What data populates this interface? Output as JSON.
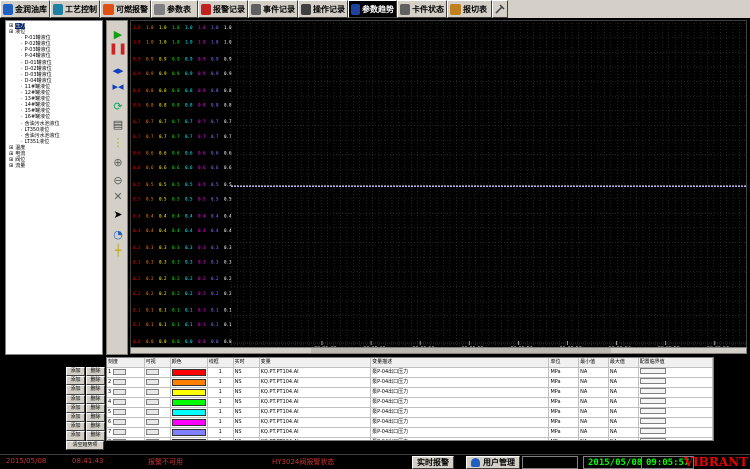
{
  "toolbar": {
    "tabs": [
      {
        "label": "金润油库",
        "icon": "monitor-icon",
        "color": "#2060c0"
      },
      {
        "label": "工艺控制",
        "icon": "globe-icon",
        "color": "#2080a0"
      },
      {
        "label": "可燃报警",
        "icon": "fire-icon",
        "color": "#e05010"
      },
      {
        "label": "参数表",
        "icon": "pen-icon",
        "color": "#808080"
      },
      {
        "label": "报警记录",
        "icon": "book-icon",
        "color": "#c02020"
      },
      {
        "label": "事件记录",
        "icon": "list-icon",
        "color": "#606060"
      },
      {
        "label": "操作记录",
        "icon": "notes-icon",
        "color": "#404040"
      },
      {
        "label": "参数趋势",
        "icon": "trend-icon",
        "color": "#2040a0"
      },
      {
        "label": "卡件状态",
        "icon": "card-icon",
        "color": "#606060"
      },
      {
        "label": "报切表",
        "icon": "switch-icon",
        "color": "#c08020"
      }
    ],
    "active_tab": "参数趋势",
    "end_icon": "tools-icon"
  },
  "tree": {
    "items": [
      {
        "label": "压力",
        "level": 0,
        "selected": true
      },
      {
        "label": "液位",
        "level": 0
      },
      {
        "label": "P-01罐液位",
        "level": 1
      },
      {
        "label": "P-02罐液位",
        "level": 1
      },
      {
        "label": "P-03罐液位",
        "level": 1
      },
      {
        "label": "P-04罐液位",
        "level": 1
      },
      {
        "label": "D-01罐液位",
        "level": 1
      },
      {
        "label": "D-02罐液位",
        "level": 1
      },
      {
        "label": "D-03罐液位",
        "level": 1
      },
      {
        "label": "D-04罐液位",
        "level": 1
      },
      {
        "label": "11#罐液位",
        "level": 1
      },
      {
        "label": "12#罐液位",
        "level": 1
      },
      {
        "label": "13#罐液位",
        "level": 1
      },
      {
        "label": "14#罐液位",
        "level": 1
      },
      {
        "label": "15#罐液位",
        "level": 1
      },
      {
        "label": "16#罐液位",
        "level": 1
      },
      {
        "label": "含油污水池液位",
        "level": 1
      },
      {
        "label": "LT350液位",
        "level": 1
      },
      {
        "label": "含油污水池液位",
        "level": 1
      },
      {
        "label": "LT351液位",
        "level": 1
      },
      {
        "label": "温度",
        "level": 0
      },
      {
        "label": "电流",
        "level": 0
      },
      {
        "label": "阀位",
        "level": 0
      },
      {
        "label": "流量",
        "level": 0
      }
    ]
  },
  "tools": [
    {
      "name": "play-icon",
      "glyph": "▶",
      "color": "#10a010"
    },
    {
      "name": "pause-icon",
      "glyph": "❚❚",
      "color": "#d02020"
    },
    {
      "name": "expand-horizontal-icon",
      "glyph": "◂▸",
      "color": "#1040c0"
    },
    {
      "name": "shrink-horizontal-icon",
      "glyph": "▸◂",
      "color": "#1040c0"
    },
    {
      "name": "refresh-icon",
      "glyph": "⟳",
      "color": "#10a060"
    },
    {
      "name": "print-icon",
      "glyph": "▤",
      "color": "#404040"
    },
    {
      "name": "cursor-line-icon",
      "glyph": "⋮",
      "color": "#c0a000"
    },
    {
      "name": "zoom-in-icon",
      "glyph": "⊕",
      "color": "#606060"
    },
    {
      "name": "zoom-out-icon",
      "glyph": "⊖",
      "color": "#606060"
    },
    {
      "name": "zoom-reset-icon",
      "glyph": "✕",
      "color": "#606060"
    },
    {
      "name": "arrow-pointer-icon",
      "glyph": "➤",
      "color": "#000"
    },
    {
      "name": "history-icon",
      "glyph": "◔",
      "color": "#2060c0"
    },
    {
      "name": "crosshair-icon",
      "glyph": "┼",
      "color": "#c0a000"
    }
  ],
  "chart_data": {
    "type": "line",
    "x_tick_labels": [
      "09:05:48",
      "09:05:49",
      "09:05:50",
      "09:05:51",
      "09:05:52",
      "09:05:53",
      "09:05:54",
      "09:05:55",
      "09:05:56",
      "09:05:57"
    ],
    "y_scale_count": 8,
    "y_scale_labels": [
      "1.0",
      "0.9",
      "0.8",
      "0.7",
      "0.6",
      "0.5",
      "0.4",
      "0.3",
      "0.2",
      "0.1",
      "0.0"
    ],
    "series": [
      {
        "name": "KQ.PT.PT104.AI",
        "color": "#ff0000"
      },
      {
        "name": "KQ.PT.PT104.AI",
        "color": "#ff8000"
      },
      {
        "name": "KQ.PT.PT104.AI",
        "color": "#ffff00"
      },
      {
        "name": "KQ.PT.PT104.AI",
        "color": "#00ff00"
      },
      {
        "name": "KQ.PT.PT104.AI",
        "color": "#00ffff"
      },
      {
        "name": "KQ.PT.PT104.AI",
        "color": "#ff00ff"
      },
      {
        "name": "KQ.PT.PT104.AI",
        "color": "#8080ff"
      },
      {
        "name": "KQ.PT.PT104.AI",
        "color": "#ffffff"
      }
    ],
    "trend_level": 0.5,
    "grid": true
  },
  "table": {
    "headers": [
      "刻度",
      "可视",
      "颜色",
      "线框",
      "实时",
      "变量",
      "变量描述",
      "单位",
      "最小值",
      "最大值",
      "配置临界值"
    ],
    "rows": [
      {
        "idx": "1",
        "color": "#ff0000",
        "width": "1",
        "realtime": "NS",
        "var": "KQ.PT.PT104.AI",
        "desc": "泵P-04出口压力",
        "unit": "MPa",
        "min": "NA",
        "max": "NA"
      },
      {
        "idx": "2",
        "color": "#ff8000",
        "width": "1",
        "realtime": "NS",
        "var": "KQ.PT.PT104.AI",
        "desc": "泵P-04出口压力",
        "unit": "MPa",
        "min": "NA",
        "max": "NA"
      },
      {
        "idx": "3",
        "color": "#ffff00",
        "width": "1",
        "realtime": "NS",
        "var": "KQ.PT.PT104.AI",
        "desc": "泵P-04出口压力",
        "unit": "MPa",
        "min": "NA",
        "max": "NA"
      },
      {
        "idx": "4",
        "color": "#00ff00",
        "width": "1",
        "realtime": "NS",
        "var": "KQ.PT.PT104.AI",
        "desc": "泵P-04出口压力",
        "unit": "MPa",
        "min": "NA",
        "max": "NA"
      },
      {
        "idx": "5",
        "color": "#00ffff",
        "width": "1",
        "realtime": "NS",
        "var": "KQ.PT.PT104.AI",
        "desc": "泵P-04出口压力",
        "unit": "MPa",
        "min": "NA",
        "max": "NA"
      },
      {
        "idx": "6",
        "color": "#ff00ff",
        "width": "1",
        "realtime": "NS",
        "var": "KQ.PT.PT104.AI",
        "desc": "泵P-04出口压力",
        "unit": "MPa",
        "min": "NA",
        "max": "NA"
      },
      {
        "idx": "7",
        "color": "#8080ff",
        "width": "1",
        "realtime": "NS",
        "var": "KQ.PT.PT104.AI",
        "desc": "泵P-04出口压力",
        "unit": "MPa",
        "min": "NA",
        "max": "NA"
      },
      {
        "idx": "8",
        "color": "#ffffff",
        "width": "1",
        "realtime": "NS",
        "var": "KQ.PT.PT104.AI",
        "desc": "泵P-04出口压力",
        "unit": "MPa",
        "min": "NA",
        "max": "NA"
      }
    ]
  },
  "side_buttons": {
    "add": "添加",
    "del": "删除",
    "clear": "清空趋势项"
  },
  "status": {
    "date_left": "2015/05/08",
    "time_left": "08:41:43",
    "msg1": "报警不可用",
    "msg2": "HY3024阀报警状态",
    "realtime_alarm": "实时报警",
    "user_mgmt": "用户管理",
    "user_icon": "user-icon",
    "date_right": "2015/05/08",
    "time_right": "09:05:57",
    "brand": "VIBRANT"
  }
}
